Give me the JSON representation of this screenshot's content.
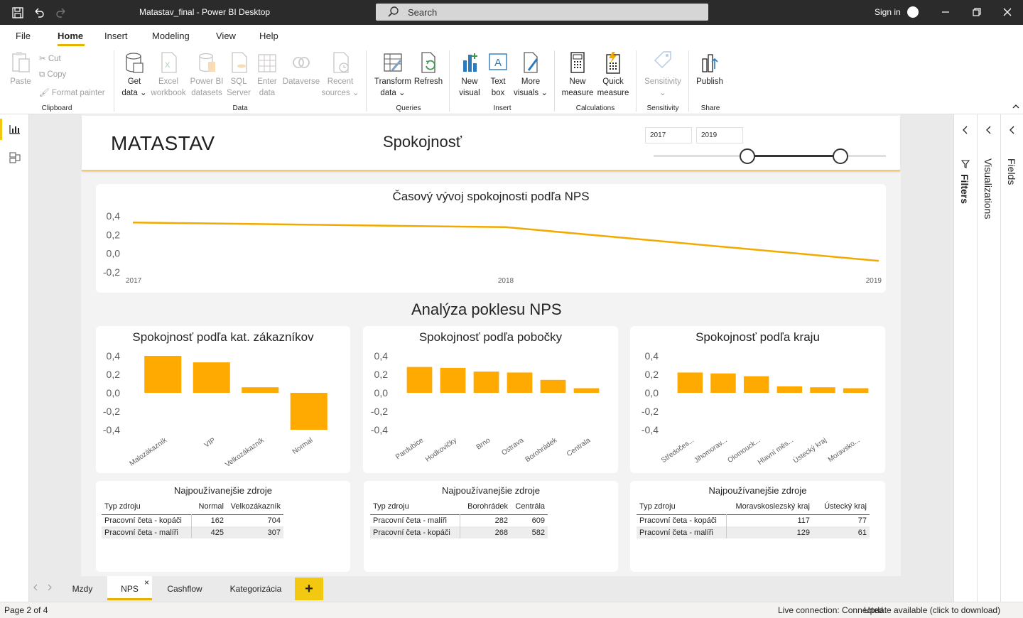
{
  "window": {
    "title": "Matastav_final - Power BI Desktop",
    "search_placeholder": "Search",
    "signin": "Sign in"
  },
  "menu": {
    "items": [
      "File",
      "Home",
      "Insert",
      "Modeling",
      "View",
      "Help"
    ],
    "active": "Home"
  },
  "ribbon": {
    "clipboard": {
      "paste": "Paste",
      "cut": "Cut",
      "copy": "Copy",
      "format_painter": "Format painter",
      "group": "Clipboard"
    },
    "data": {
      "get_data_1": "Get",
      "get_data_2": "data",
      "excel_1": "Excel",
      "excel_2": "workbook",
      "pbi_1": "Power BI",
      "pbi_2": "datasets",
      "sql_1": "SQL",
      "sql_2": "Server",
      "enter_1": "Enter",
      "enter_2": "data",
      "dataverse": "Dataverse",
      "recent_1": "Recent",
      "recent_2": "sources",
      "group": "Data"
    },
    "queries": {
      "transform_1": "Transform",
      "transform_2": "data",
      "refresh": "Refresh",
      "group": "Queries"
    },
    "insert": {
      "new_visual_1": "New",
      "new_visual_2": "visual",
      "text_box_1": "Text",
      "text_box_2": "box",
      "more_visuals_1": "More",
      "more_visuals_2": "visuals",
      "group": "Insert"
    },
    "calculations": {
      "new_measure_1": "New",
      "new_measure_2": "measure",
      "quick_measure_1": "Quick",
      "quick_measure_2": "measure",
      "group": "Calculations"
    },
    "sensitivity": {
      "label": "Sensitivity",
      "group": "Sensitivity"
    },
    "share": {
      "publish": "Publish",
      "group": "Share"
    }
  },
  "report": {
    "logo": "MATASTAV",
    "title": "Spokojnosť",
    "year_from": "2017",
    "year_to": "2019",
    "slider_from_fraction": 0.4,
    "slider_to_fraction": 0.8,
    "section_title": "Analýza poklesu NPS"
  },
  "chart_data": [
    {
      "type": "line",
      "title": "Časový vývoj spokojnosti podľa NPS",
      "x": [
        "2017",
        "2018",
        "2019"
      ],
      "y_ticks": [
        "0,4",
        "0,2",
        "0,0",
        "-0,2"
      ],
      "ylim": [
        -0.2,
        0.4
      ],
      "series": [
        {
          "values": [
            0.33,
            0.28,
            -0.08
          ]
        }
      ],
      "color": "#f2a900"
    },
    {
      "type": "bar",
      "title": "Spokojnosť podľa kat. zákazníkov",
      "categories": [
        "Malozákazník",
        "VIP",
        "Velkozákazník",
        "Normal"
      ],
      "values": [
        0.4,
        0.33,
        0.06,
        -0.4
      ],
      "y_ticks": [
        "0,4",
        "0,2",
        "0,0",
        "-0,2",
        "-0,4"
      ],
      "ylim": [
        -0.4,
        0.4
      ],
      "color": "#ffaa00"
    },
    {
      "type": "bar",
      "title": "Spokojnosť podľa pobočky",
      "categories": [
        "Pardubice",
        "Hodkovičky",
        "Brno",
        "Ostrava",
        "Borohrádek",
        "Centrala"
      ],
      "values": [
        0.28,
        0.27,
        0.23,
        0.22,
        0.14,
        0.05
      ],
      "y_ticks": [
        "0,4",
        "0,2",
        "0,0",
        "-0,2",
        "-0,4"
      ],
      "ylim": [
        -0.4,
        0.4
      ],
      "color": "#ffaa00"
    },
    {
      "type": "bar",
      "title": "Spokojnosť podľa kraju",
      "categories": [
        "Středočes...",
        "Jihomorav...",
        "Olomouck...",
        "Hlavní měs...",
        "Ústecký kraj",
        "Moravsko..."
      ],
      "values": [
        0.22,
        0.21,
        0.18,
        0.07,
        0.06,
        0.05
      ],
      "y_ticks": [
        "0,4",
        "0,2",
        "0,0",
        "-0,2",
        "-0,4"
      ],
      "ylim": [
        -0.4,
        0.4
      ],
      "color": "#ffaa00"
    }
  ],
  "tables": [
    {
      "title": "Najpoužívanejšie zdroje",
      "headers": [
        "Typ zdroju",
        "Normal",
        "Velkozákazník"
      ],
      "rows": [
        [
          "Pracovní četa - kopáči",
          "162",
          "704"
        ],
        [
          "Pracovní četa - malíři",
          "425",
          "307"
        ]
      ]
    },
    {
      "title": "Najpoužívanejšie zdroje",
      "headers": [
        "Typ zdroju",
        "Borohrádek",
        "Centrála"
      ],
      "rows": [
        [
          "Pracovní četa - malíři",
          "282",
          "609"
        ],
        [
          "Pracovní četa - kopáči",
          "268",
          "582"
        ]
      ]
    },
    {
      "title": "Najpoužívanejšie zdroje",
      "headers": [
        "Typ zdroju",
        "Moravskoslezský kraj",
        "Ústecký kraj"
      ],
      "rows": [
        [
          "Pracovní četa - kopáči",
          "117",
          "77"
        ],
        [
          "Pracovní četa - malíři",
          "129",
          "61"
        ]
      ]
    }
  ],
  "panes": {
    "filters": "Filters",
    "visualizations": "Visualizations",
    "fields": "Fields"
  },
  "tabs": {
    "items": [
      "Mzdy",
      "NPS",
      "Cashflow",
      "Kategorizácia"
    ],
    "active": "NPS",
    "close": "×",
    "add": "+"
  },
  "status": {
    "page": "Page 2 of 4",
    "connection": "Live connection: Connected",
    "update": "Update available (click to download)"
  },
  "colors": {
    "accent": "#f2c811",
    "bar": "#ffaa00",
    "titlebar": "#2b2b2b"
  }
}
